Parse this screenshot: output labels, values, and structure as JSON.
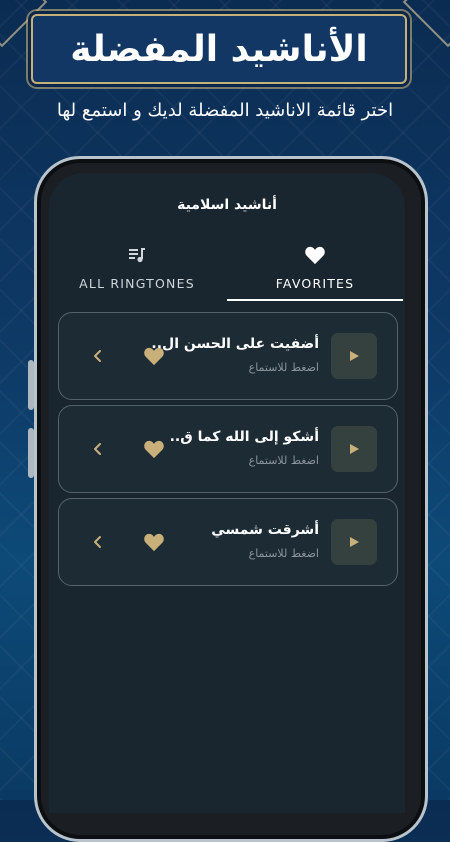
{
  "banner": {
    "title": "الأناشيد المفضلة",
    "subtitle": "اختر قائمة الاناشيد المفضلة لديك و استمع لها"
  },
  "app": {
    "title": "أناشيد اسلامية"
  },
  "tabs": [
    {
      "label": "ALL RINGTONES",
      "icon": "playlist-icon",
      "selected": false
    },
    {
      "label": "FAVORITES",
      "icon": "heart-icon",
      "selected": true
    }
  ],
  "songs": [
    {
      "title": "أضفيت على الحسن ال..",
      "subtitle": "اضغط للاستماع",
      "favorite": true
    },
    {
      "title": "أشكو إلى الله كما ق..",
      "subtitle": "اضغط للاستماع",
      "favorite": true
    },
    {
      "title": "أشرقت شمسي",
      "subtitle": "اضغط للاستماع",
      "favorite": true
    }
  ],
  "colors": {
    "accent_gold": "#c9b07a",
    "screen_bg": "#19252f",
    "card_bg": "#1d2b35",
    "background_blue": "#0e3a67"
  }
}
